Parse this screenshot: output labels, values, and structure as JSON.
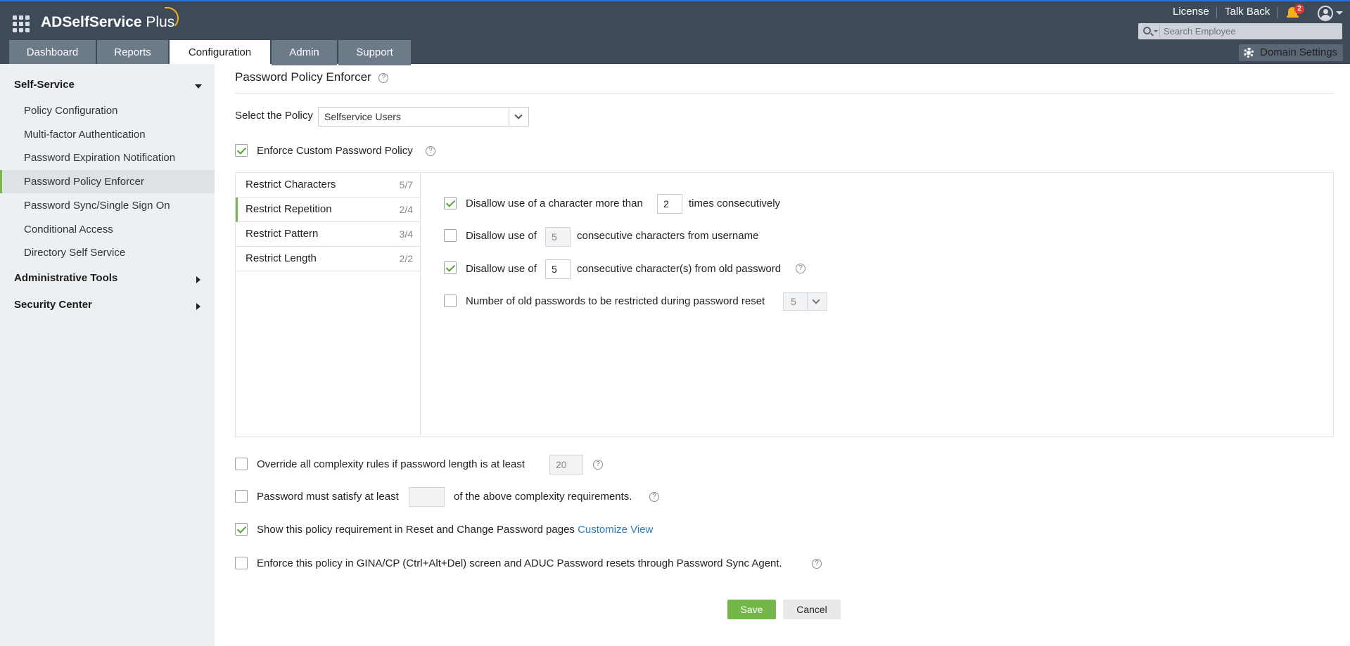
{
  "app": {
    "title_bold": "ADSelfService",
    "title_light": " Plus"
  },
  "header": {
    "license": "License",
    "talk_back": "Talk Back",
    "notification_count": "2",
    "search_placeholder": "Search Employee"
  },
  "tabs": [
    {
      "label": "Dashboard"
    },
    {
      "label": "Reports"
    },
    {
      "label": "Configuration"
    },
    {
      "label": "Admin"
    },
    {
      "label": "Support"
    }
  ],
  "domain_settings": "Domain Settings",
  "sidebar": {
    "self_service": "Self-Service",
    "items": [
      {
        "label": "Policy Configuration"
      },
      {
        "label": "Multi-factor Authentication"
      },
      {
        "label": "Password Expiration Notification"
      },
      {
        "label": "Password Policy Enforcer"
      },
      {
        "label": "Password Sync/Single Sign On"
      },
      {
        "label": "Conditional Access"
      },
      {
        "label": "Directory Self Service"
      }
    ],
    "administrative_tools": "Administrative Tools",
    "security_center": "Security Center"
  },
  "main": {
    "title": "Password Policy Enforcer",
    "help_glyph": "?",
    "select_policy_label": "Select the Policy",
    "select_policy_value": "Selfservice Users",
    "enforce_custom": "Enforce Custom Password Policy",
    "restriction_tabs": [
      {
        "label": "Restrict Characters",
        "count": "5/7"
      },
      {
        "label": "Restrict Repetition",
        "count": "2/4"
      },
      {
        "label": "Restrict Pattern",
        "count": "3/4"
      },
      {
        "label": "Restrict Length",
        "count": "2/2"
      }
    ],
    "rules": {
      "r1_prefix": "Disallow use of a character more than",
      "r1_value": "2",
      "r1_suffix": "times consecutively",
      "r2_prefix": "Disallow use of",
      "r2_value": "5",
      "r2_suffix": "consecutive characters from username",
      "r3_prefix": "Disallow use of",
      "r3_value": "5",
      "r3_suffix": "consecutive character(s) from old password",
      "r4_label": "Number of old passwords to be restricted during password reset",
      "r4_value": "5"
    },
    "override_label": "Override all complexity rules if password length is at least",
    "override_value": "20",
    "satisfy_prefix": "Password must satisfy at least",
    "satisfy_suffix": "of the above complexity requirements.",
    "show_policy_label": "Show this policy requirement in Reset and Change Password pages",
    "customize_view": "Customize View",
    "enforce_gina": "Enforce this policy in GINA/CP (Ctrl+Alt+Del) screen and ADUC Password resets through Password Sync Agent.",
    "save": "Save",
    "cancel": "Cancel"
  },
  "colors": {
    "header_bg": "#3e4a57",
    "accent_green": "#72b748",
    "link_blue": "#2a7bbd",
    "badge_red": "#e53935"
  }
}
